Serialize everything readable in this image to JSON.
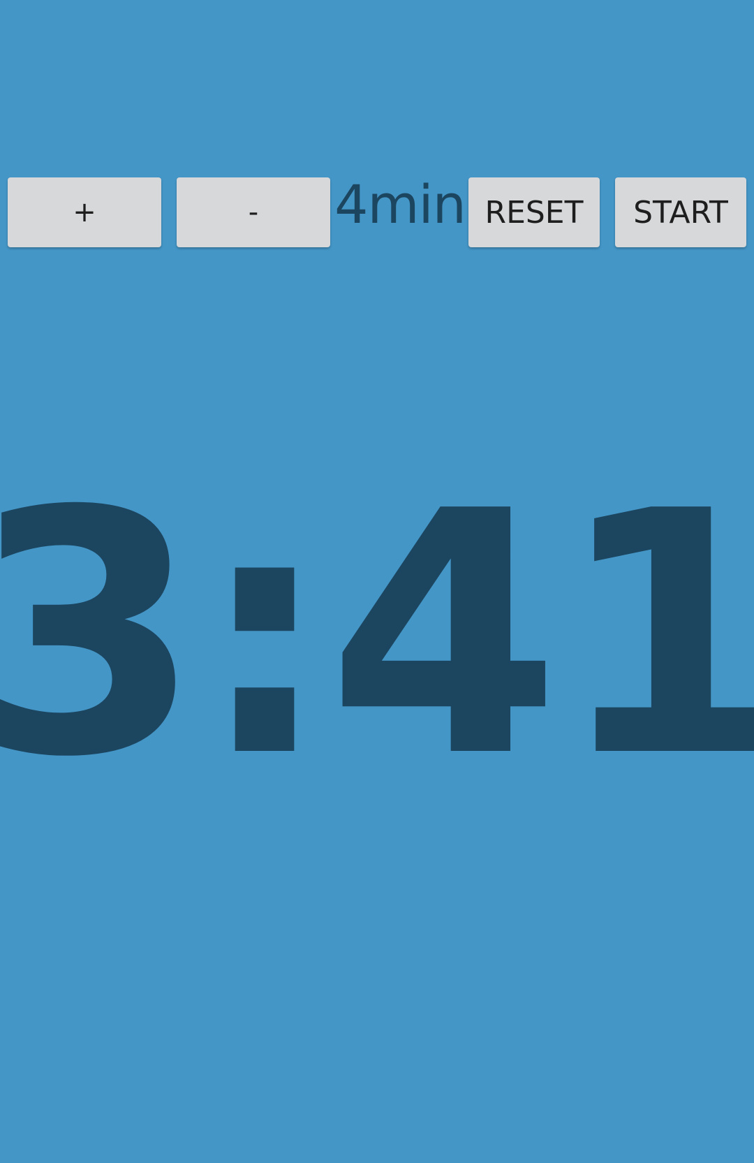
{
  "controls": {
    "increment_label": "+",
    "decrement_label": "-",
    "duration_label": "4min",
    "reset_label": "RESET",
    "start_label": "START"
  },
  "timer": {
    "display": "3:41"
  },
  "colors": {
    "background": "#4496c7",
    "button_background": "#d6d8d9",
    "text_dark": "#1c4560",
    "button_text": "#1e1e1e"
  }
}
